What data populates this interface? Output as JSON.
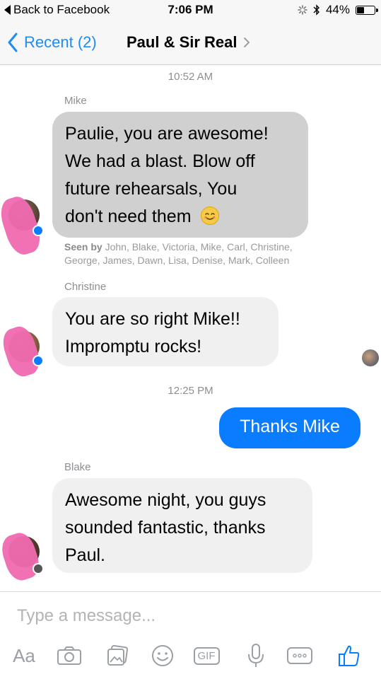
{
  "status_bar": {
    "back_label": "Back to Facebook",
    "time": "7:06 PM",
    "battery_text": "44%",
    "battery_level": 0.44
  },
  "nav": {
    "back_label": "Recent (2)",
    "title": "Paul & Sir Real"
  },
  "messages": {
    "time1": "10:52 AM",
    "msg1": {
      "sender": "Mike",
      "lines": [
        "Paulie, you are awesome!",
        "We had a blast.  Blow off",
        "future rehearsals, You",
        "don't need them"
      ]
    },
    "seen": {
      "prefix": "Seen by",
      "names": "John, Blake, Victoria, Mike, Carl, Christine,",
      "names2": "George, James, Dawn, Lisa, Denise, Mark, Colleen"
    },
    "msg2": {
      "sender": "Christine",
      "lines": [
        "You are so right Mike!!",
        "Impromptu rocks!"
      ]
    },
    "time2": "12:25 PM",
    "msg3": {
      "text": "Thanks Mike"
    },
    "msg4": {
      "sender": "Blake",
      "lines": [
        "Awesome night, you guys",
        "sounded fantastic, thanks",
        "Paul."
      ]
    }
  },
  "composer": {
    "placeholder": "Type a message...",
    "aa_label": "Aa",
    "gif_label": "GIF"
  },
  "colors": {
    "accent": "#0a7cff",
    "incoming_bubble": "#f1f0f0",
    "incoming_bubble_dark": "#d0d0d0"
  }
}
